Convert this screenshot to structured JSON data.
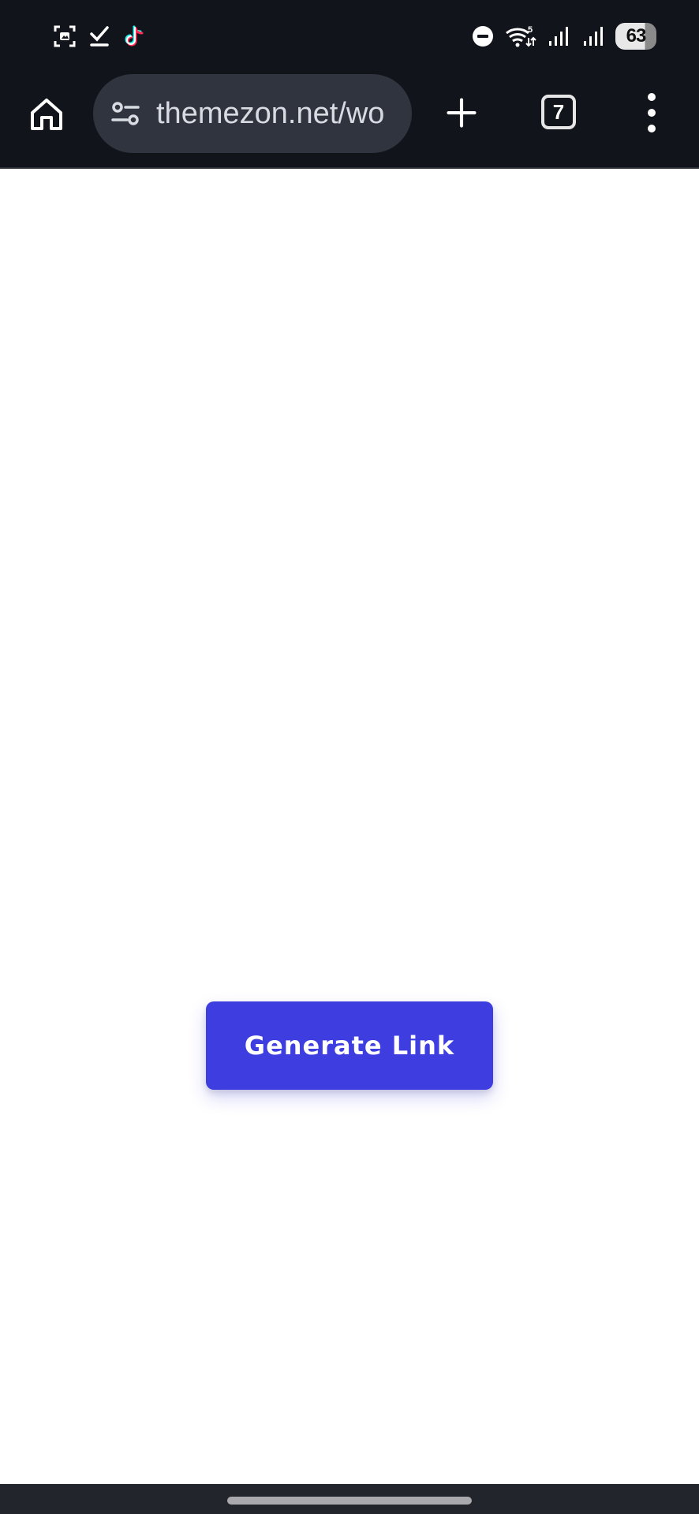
{
  "status_bar": {
    "left_icons": [
      "screenshot-icon",
      "checkmark-icon",
      "tiktok-icon"
    ],
    "right_icons": [
      "do-not-disturb-icon",
      "wifi-icon",
      "signal-icon",
      "signal-icon"
    ],
    "wifi_label": "5",
    "battery": "63"
  },
  "browser": {
    "url": "themezon.net/wo",
    "tab_count": "7",
    "icons": {
      "home": "home-icon",
      "site_settings": "tune-icon",
      "new_tab": "plus-icon",
      "menu": "more-vert-icon"
    }
  },
  "page": {
    "generate_button_label": "Generate Link"
  },
  "colors": {
    "chrome_bg": "#11141b",
    "url_pill_bg": "#30343f",
    "button_bg": "#3d3de0",
    "button_text": "#ffffff",
    "nav_bar_bg": "#22252b"
  }
}
